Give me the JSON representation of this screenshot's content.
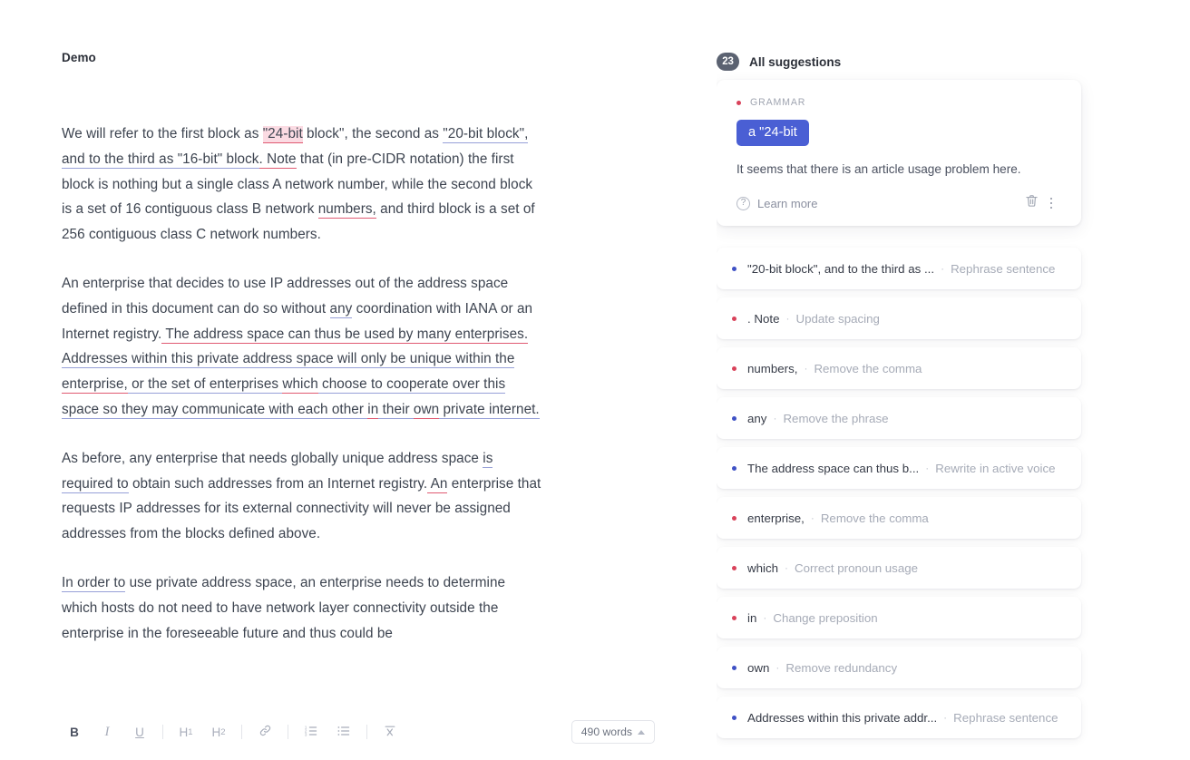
{
  "document": {
    "title": "Demo",
    "paragraphs": [
      {
        "id": "p1",
        "runs": [
          {
            "text": "We will refer to the first block as ",
            "mark": "none"
          },
          {
            "text": "\"24-bit",
            "mark": "highlight"
          },
          {
            "text": " block\", the second as ",
            "mark": "none"
          },
          {
            "text": "\"20-bit block\", and to the third as \"16-bit\" block",
            "mark": "blue"
          },
          {
            "text": ". Note",
            "mark": "red"
          },
          {
            "text": " that (in pre-CIDR notation) the first block is nothing but a single class A network number, while the second block is a set of 16 contiguous class B network ",
            "mark": "none"
          },
          {
            "text": "numbers,",
            "mark": "red"
          },
          {
            "text": " and third block is a set of 256 contiguous class C network numbers.",
            "mark": "none"
          }
        ]
      },
      {
        "id": "p2",
        "runs": [
          {
            "text": "An enterprise that decides to use IP addresses out of the address space defined in this document can do so without ",
            "mark": "none"
          },
          {
            "text": "any",
            "mark": "blue"
          },
          {
            "text": " coordination with IANA or an Internet registry.",
            "mark": "none"
          },
          {
            "text": " The address space can thus be used by many enterprises.",
            "mark": "red"
          },
          {
            "text": " Addresses within this private address space will only be unique within the ",
            "mark": "blue"
          },
          {
            "text": "enterprise,",
            "mark": "red"
          },
          {
            "text": " or the set of enterprises ",
            "mark": "blue"
          },
          {
            "text": "which",
            "mark": "red"
          },
          {
            "text": " choose to cooperate over this space so they may communicate with each other ",
            "mark": "blue"
          },
          {
            "text": "in",
            "mark": "red"
          },
          {
            "text": " their ",
            "mark": "blue"
          },
          {
            "text": "own",
            "mark": "red"
          },
          {
            "text": " private internet.",
            "mark": "blue"
          }
        ]
      },
      {
        "id": "p3",
        "runs": [
          {
            "text": "As before, any enterprise that needs globally unique address space ",
            "mark": "none"
          },
          {
            "text": "is required to",
            "mark": "blue"
          },
          {
            "text": " obtain such addresses from an Internet registry.",
            "mark": "none"
          },
          {
            "text": " An",
            "mark": "red"
          },
          {
            "text": " enterprise that requests IP addresses for its external connectivity will never be assigned addresses from the blocks defined above.",
            "mark": "none"
          }
        ]
      },
      {
        "id": "p4",
        "runs": [
          {
            "text": "In order to",
            "mark": "blue"
          },
          {
            "text": " use private address space, an enterprise needs to determine which hosts do not need to have network layer connectivity outside the enterprise in the foreseeable future and thus could be",
            "mark": "none"
          }
        ]
      }
    ]
  },
  "toolbar": {
    "bold_label": "B",
    "italic_label": "I",
    "underline_label": "U",
    "h1_label": "H",
    "h1_sub": "1",
    "h2_label": "H",
    "h2_sub": "2",
    "link_icon": "link-icon",
    "numbered_list_icon": "numbered-list-icon",
    "bullet_list_icon": "bullet-list-icon",
    "clear_format_icon": "clear-formatting-icon",
    "word_count_label": "490 words"
  },
  "suggestions": {
    "count_badge": "23",
    "header_title": "All suggestions",
    "expanded_card": {
      "type_label": "GRAMMAR",
      "type_color": "#d9425a",
      "replacement": "a \"24-bit",
      "replacement_color": "#4a5fd4",
      "description": "It seems that there is an article usage problem here.",
      "learn_more_label": "Learn more",
      "delete_icon": "trash-icon",
      "more_icon": "kebab-menu-icon"
    },
    "items": [
      {
        "text": "\"20-bit block\", and to the third as ...",
        "action": "Rephrase sentence",
        "color": "blue"
      },
      {
        "text": ". Note",
        "action": "Update spacing",
        "color": "red"
      },
      {
        "text": "numbers,",
        "action": "Remove the comma",
        "color": "red"
      },
      {
        "text": "any",
        "action": "Remove the phrase",
        "color": "blue"
      },
      {
        "text": "The address space can thus b...",
        "action": "Rewrite in active voice",
        "color": "blue"
      },
      {
        "text": "enterprise,",
        "action": "Remove the comma",
        "color": "red"
      },
      {
        "text": "which",
        "action": "Correct pronoun usage",
        "color": "red"
      },
      {
        "text": "in",
        "action": "Change preposition",
        "color": "red"
      },
      {
        "text": "own",
        "action": "Remove redundancy",
        "color": "blue"
      },
      {
        "text": "Addresses within this private addr...",
        "action": "Rephrase sentence",
        "color": "blue"
      }
    ],
    "separator": "·"
  },
  "colors": {
    "grammar_red": "#d9425a",
    "rephrase_blue": "#3f51c5",
    "pill_blue": "#4a5fd4",
    "highlight_pink": "#fbdbe3",
    "badge_slate": "#5b6271"
  }
}
